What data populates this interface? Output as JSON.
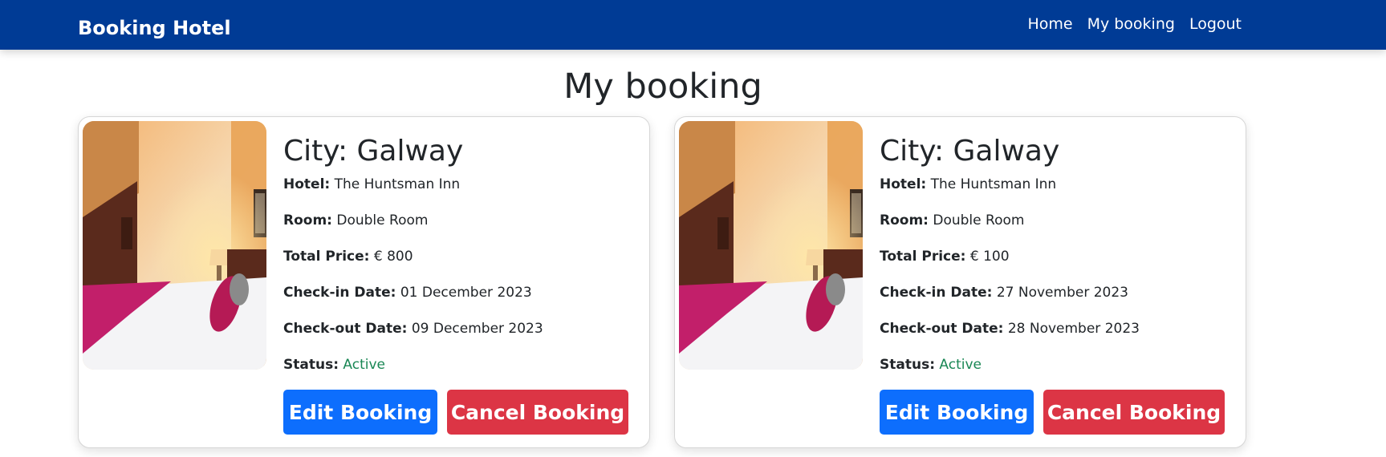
{
  "navbar": {
    "brand": "Booking Hotel",
    "links": [
      "Home",
      "My booking",
      "Logout"
    ],
    "color": "#003b95"
  },
  "page": {
    "title": "My booking"
  },
  "bookings": [
    {
      "city": "City: Galway",
      "hotel_label": "Hotel:",
      "hotel": "The Huntsman Inn",
      "room_label": "Room:",
      "room": "Double Room",
      "price_label": "Total Price:",
      "price": "€ 800",
      "checkin_label": "Check-in Date:",
      "checkin": "01 December 2023",
      "checkout_label": "Check-out Date:",
      "checkout": "09 December 2023",
      "status_label": "Status:",
      "status": "Active",
      "edit_label": "Edit Booking",
      "cancel_label": "Cancel Booking",
      "image_icon": "hotel-room-photo"
    },
    {
      "city": "City: Galway",
      "hotel_label": "Hotel:",
      "hotel": "The Huntsman Inn",
      "room_label": "Room:",
      "room": "Double Room",
      "price_label": "Total Price:",
      "price": "€ 100",
      "checkin_label": "Check-in Date:",
      "checkin": "27 November 2023",
      "checkout_label": "Check-out Date:",
      "checkout": "28 November 2023",
      "status_label": "Status:",
      "status": "Active",
      "edit_label": "Edit Booking",
      "cancel_label": "Cancel Booking",
      "image_icon": "hotel-room-photo"
    }
  ],
  "colors": {
    "edit": "#0d6efd",
    "cancel": "#dc3545",
    "active": "#198754"
  }
}
